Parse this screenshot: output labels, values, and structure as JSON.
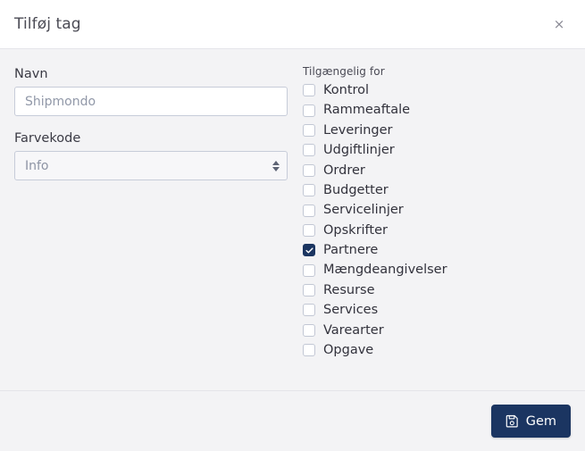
{
  "dialog": {
    "title": "Tilføj tag",
    "close_icon": "close-icon",
    "close_label": "×"
  },
  "form": {
    "name": {
      "label": "Navn",
      "value": "",
      "placeholder": "Shipmondo"
    },
    "colorcode": {
      "label": "Farvekode",
      "value": "Info",
      "options": [
        "Info"
      ],
      "icon": "chevron-updown-icon"
    }
  },
  "availability": {
    "label": "Tilgængelig for",
    "items": [
      {
        "label": "Kontrol",
        "checked": false
      },
      {
        "label": "Rammeaftale",
        "checked": false
      },
      {
        "label": "Leveringer",
        "checked": false
      },
      {
        "label": "Udgiftlinjer",
        "checked": false
      },
      {
        "label": "Ordrer",
        "checked": false
      },
      {
        "label": "Budgetter",
        "checked": false
      },
      {
        "label": "Servicelinjer",
        "checked": false
      },
      {
        "label": "Opskrifter",
        "checked": false
      },
      {
        "label": "Partnere",
        "checked": true
      },
      {
        "label": "Mængdeangivelser",
        "checked": false
      },
      {
        "label": "Resurse",
        "checked": false
      },
      {
        "label": "Services",
        "checked": false
      },
      {
        "label": "Varearter",
        "checked": false
      },
      {
        "label": "Opgave",
        "checked": false
      }
    ]
  },
  "footer": {
    "save_label": "Gem",
    "save_icon": "save-floppy-icon"
  },
  "colors": {
    "accent": "#1b3561",
    "body_bg": "#f3f3f5",
    "header_bg": "#ffffff",
    "border": "#c7ccd9",
    "text": "#32323c",
    "muted_text": "#9198a8"
  }
}
